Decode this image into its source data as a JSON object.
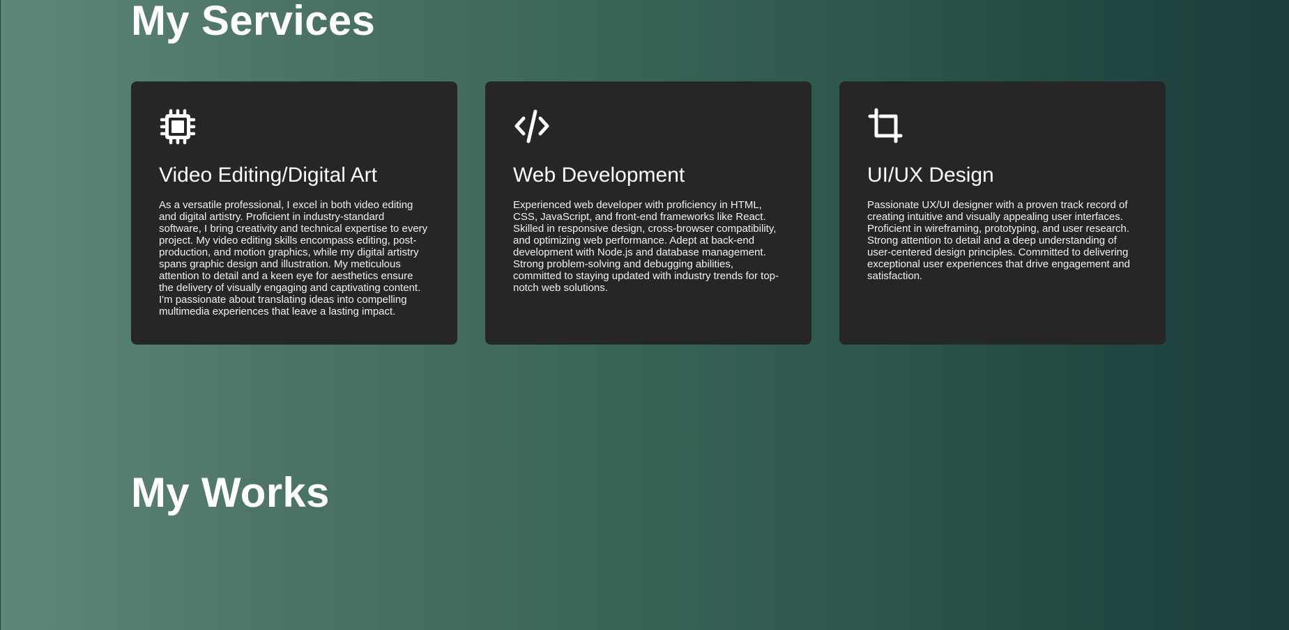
{
  "services": {
    "title": "My Services",
    "cards": [
      {
        "icon": "chip-icon",
        "title": "Video Editing/Digital Art",
        "description": "As a versatile professional, I excel in both video editing and digital artistry. Proficient in industry-standard software, I bring creativity and technical expertise to every project. My video editing skills encompass editing, post-production, and motion graphics, while my digital artistry spans graphic design and illustration. My meticulous attention to detail and a keen eye for aesthetics ensure the delivery of visually engaging and captivating content. I'm passionate about translating ideas into compelling multimedia experiences that leave a lasting impact."
      },
      {
        "icon": "code-icon",
        "title": "Web Development",
        "description": "Experienced web developer with proficiency in HTML, CSS, JavaScript, and front-end frameworks like React. Skilled in responsive design, cross-browser compatibility, and optimizing web performance. Adept at back-end development with Node.js and database management. Strong problem-solving and debugging abilities, committed to staying updated with industry trends for top-notch web solutions."
      },
      {
        "icon": "crop-icon",
        "title": "UI/UX Design",
        "description": "Passionate UX/UI designer with a proven track record of creating intuitive and visually appealing user interfaces. Proficient in wireframing, prototyping, and user research. Strong attention to detail and a deep understanding of user-centered design principles. Committed to delivering exceptional user experiences that drive engagement and satisfaction."
      }
    ]
  },
  "works": {
    "title": "My Works"
  }
}
